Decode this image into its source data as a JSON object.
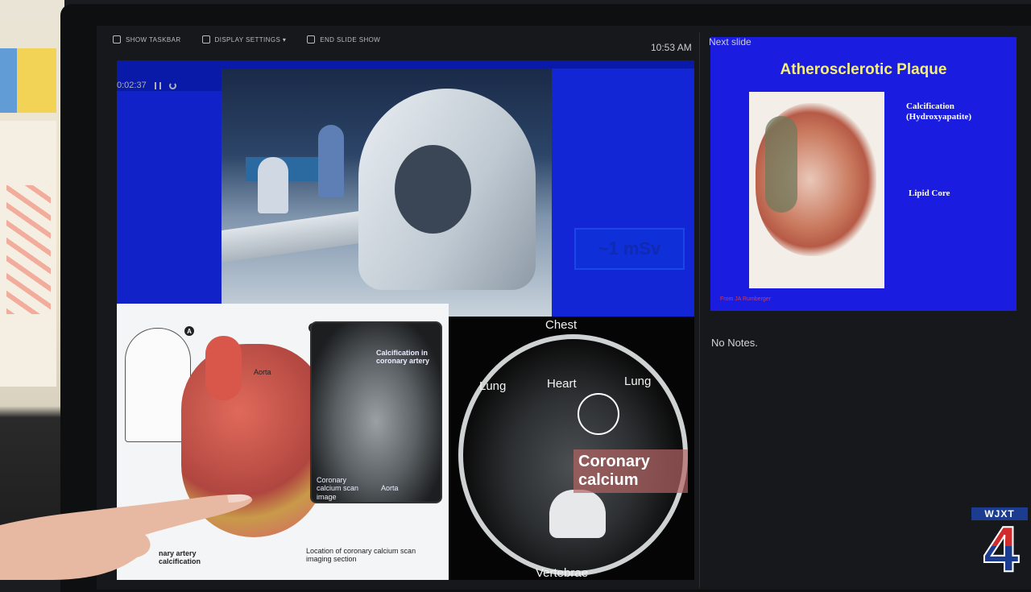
{
  "toolbar": {
    "show_taskbar": "SHOW TASKBAR",
    "display_settings": "DISPLAY SETTINGS ▾",
    "end_slide_show": "END SLIDE SHOW"
  },
  "clock": "10:53 AM",
  "timer": "0:02:37",
  "current_slide": {
    "dose_label": "~1 mSv",
    "diagram": {
      "badge_a": "A",
      "badge_b": "B",
      "aorta": "Aorta",
      "calcification_coronary": "Calcification in coronary artery",
      "coronary_calcium_scan_image": "Coronary calcium scan image",
      "aorta_scan": "Aorta",
      "coronary_artery_calcification": "nary artery calcification",
      "location_caption": "Location of coronary calcium scan imaging section"
    },
    "axial": {
      "chest": "Chest",
      "lung_left": "Lung",
      "heart": "Heart",
      "lung_right": "Lung",
      "coronary_calcium": "Coronary calcium",
      "vertebrae": "Vertebrae"
    }
  },
  "next_slide": {
    "label": "Next slide",
    "title": "Atherosclerotic Plaque",
    "calcification": "Calcification (Hydroxyapatite)",
    "lipid_core": "Lipid Core",
    "credit": "From JA Rumberger"
  },
  "notes": "No Notes.",
  "station": {
    "call_letters": "WJXT",
    "channel": "4"
  }
}
